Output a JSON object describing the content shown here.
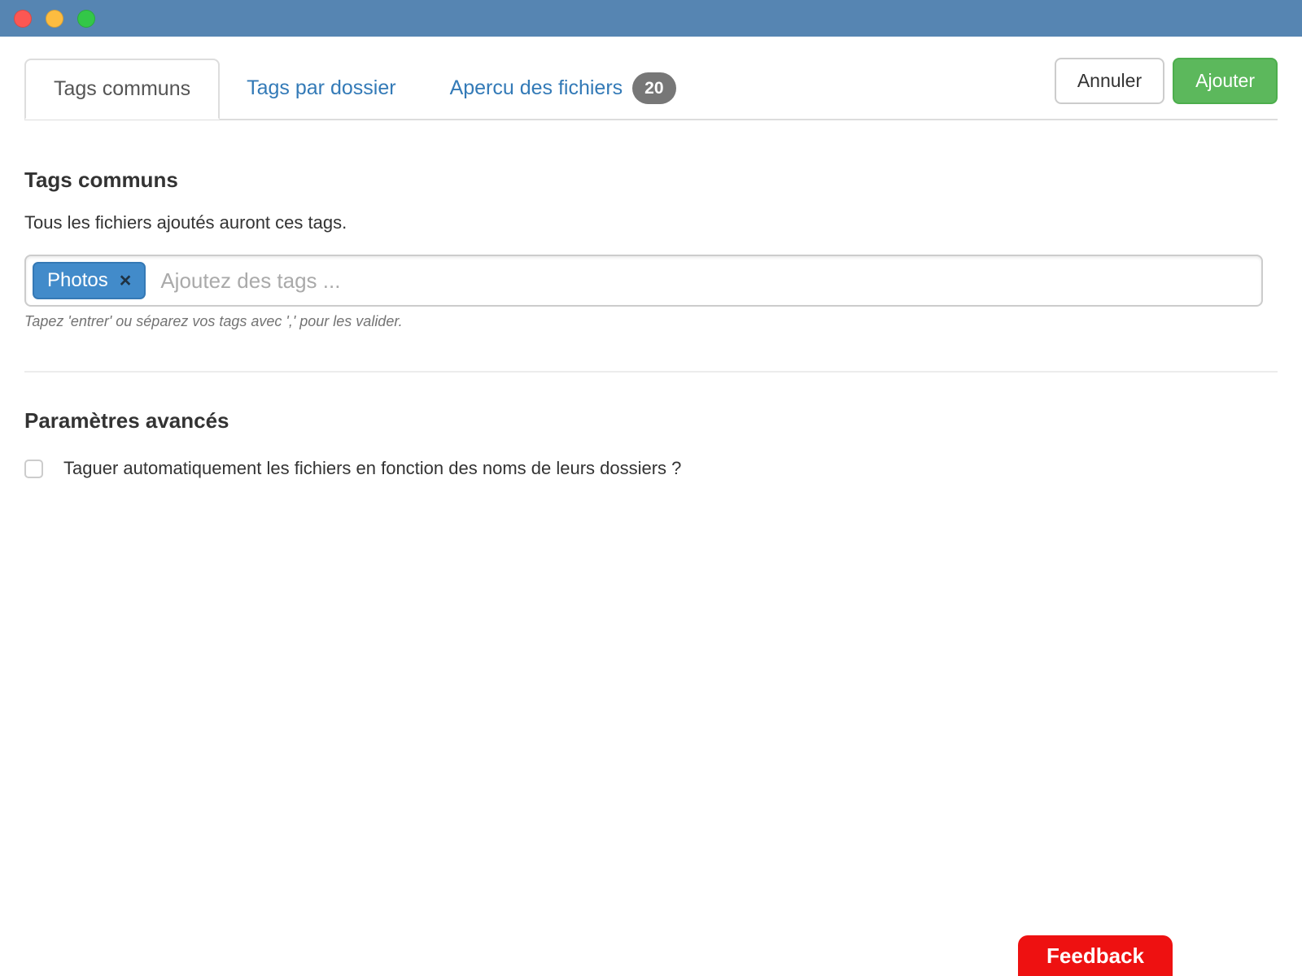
{
  "window": {
    "traffic_lights": [
      {
        "icon": "close-icon"
      },
      {
        "icon": "minimize-icon"
      },
      {
        "icon": "zoom-icon"
      }
    ],
    "titlebar_color": "#5685b2"
  },
  "tabs": [
    {
      "label": "Tags communs",
      "active": true
    },
    {
      "label": "Tags par dossier",
      "active": false
    },
    {
      "label": "Apercu des fichiers",
      "active": false,
      "badge": "20"
    }
  ],
  "actions": {
    "cancel_label": "Annuler",
    "submit_label": "Ajouter"
  },
  "common_tags": {
    "title": "Tags communs",
    "description": "Tous les fichiers ajoutés auront ces tags.",
    "tags": [
      {
        "label": "Photos",
        "close_icon": "×"
      }
    ],
    "input_placeholder": "Ajoutez des tags ...",
    "hint": "Tapez 'entrer' ou séparez vos tags avec ',' pour les valider."
  },
  "advanced": {
    "title": "Paramètres avancés",
    "checkbox_label": "Taguer automatiquement les fichiers en fonction des noms de leurs dossiers ?",
    "checkbox_checked": false
  },
  "feedback": {
    "label": "Feedback"
  },
  "colors": {
    "accent_blue": "#337ab7",
    "tag_blue": "#428bca",
    "success_green": "#5cb85c",
    "badge_gray": "#777777",
    "feedback_red": "#ee1111"
  }
}
